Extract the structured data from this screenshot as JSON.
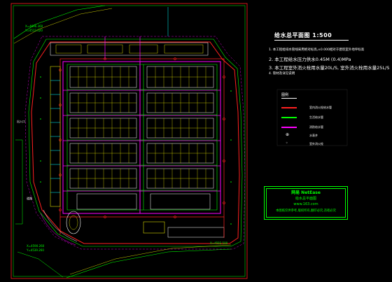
{
  "drawing": {
    "title": "给水总平面图  1:500",
    "notes": [
      {
        "text": "1. 本工程给排水管线采用绝对标高,±0.000相对于建筑室外地坪标高",
        "size": "small"
      },
      {
        "text": "2. 本工程给水压力供水0.45M (0.4)MPa",
        "size": "large"
      },
      {
        "text": "3. 本工程室外消火栓用水量20L/S, 室外消火栓用水量25L/S",
        "size": "large"
      },
      {
        "text": "4. 管材及详见说明",
        "size": "small"
      }
    ],
    "legend": {
      "title": "图例",
      "items": [
        {
          "kind": "line",
          "color": "#ff2020",
          "label": "室内消火栓给水管"
        },
        {
          "kind": "line",
          "color": "#00ff00",
          "label": "生活给水管"
        },
        {
          "kind": "line",
          "color": "#ff00ff",
          "label": "消防给水管"
        },
        {
          "kind": "symbol",
          "symbol": "⊕",
          "label": "水表井"
        },
        {
          "kind": "symbol",
          "symbol": "◦",
          "label": "室外消火栓"
        }
      ]
    },
    "stamp": {
      "line1": "网易 NetEase",
      "line2": "给水总平面图",
      "line3": "www.163.com",
      "line4": "本图纸仅供参考,版权所有,翻印必究,违者必究"
    },
    "labels": {
      "top_left_coord_1": "X=4696.360",
      "top_left_coord_2": "Y=4512.020",
      "entrance_label": "出入口",
      "left_label": "道路",
      "bottom_coord_1": "X=4590.260",
      "bottom_coord_2": "Y=4539.260",
      "bottom_right_coord": "X=4592.500"
    },
    "colors": {
      "red": "#ff2020",
      "green": "#00ff00",
      "magenta": "#ff00ff",
      "yellow": "#ffff00",
      "cyan": "#00ffff",
      "white": "#ffffff"
    }
  }
}
